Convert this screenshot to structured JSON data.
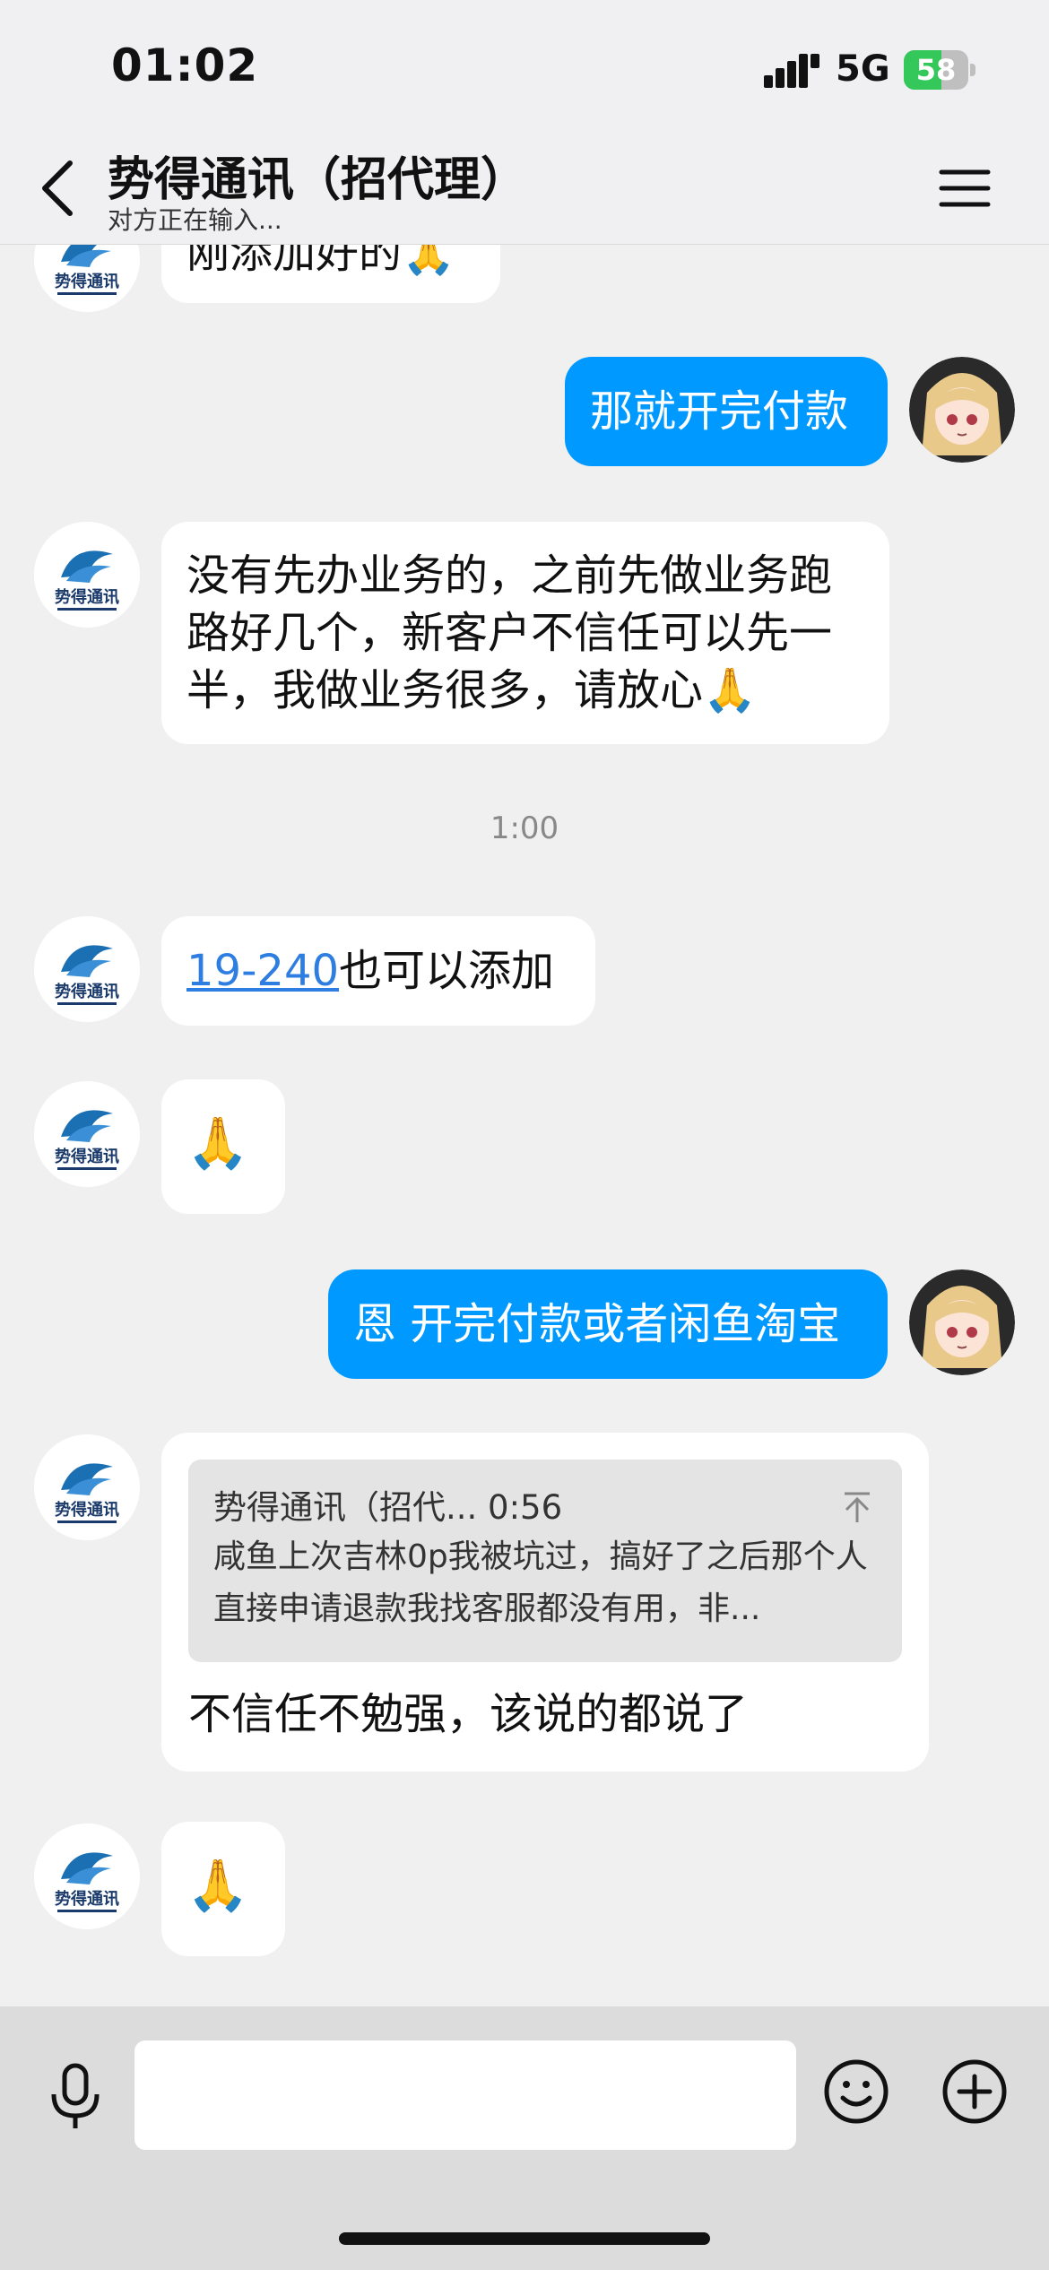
{
  "status_bar": {
    "time": "01:02",
    "network": "5G",
    "battery_level": "58"
  },
  "header": {
    "title": "势得通讯（招代理）",
    "subtitle": "对方正在输入..."
  },
  "messages": {
    "m0": {
      "text": "刚添加好的🙏"
    },
    "m1": {
      "text": "那就开完付款"
    },
    "m2": {
      "text": "没有先办业务的，之前先做业务跑路好几个，新客户不信任可以先一半，我做业务很多，请放心🙏"
    },
    "time1": "1:00",
    "m3": {
      "link": "19-240",
      "text": "也可以添加"
    },
    "m4": {
      "text": "🙏"
    },
    "m5": {
      "text": "恩 开完付款或者闲鱼淘宝"
    },
    "m6": {
      "quote_header": "势得通讯（招代... 0:56",
      "quote_body": "咸鱼上次吉林0p我被坑过，搞好了之后那个人直接申请退款我找客服都没有用，非...",
      "text": "不信任不勉强，该说的都说了"
    },
    "m7": {
      "text": "🙏"
    }
  },
  "colors": {
    "outgoing": "#0099ff",
    "incoming": "#ffffff",
    "background": "#f0f0f0",
    "link": "#2e7de0"
  },
  "icons": [
    "signal-icon",
    "battery-icon",
    "back-icon",
    "menu-icon",
    "voice-icon",
    "emoji-icon",
    "plus-icon",
    "quote-expand-icon"
  ]
}
